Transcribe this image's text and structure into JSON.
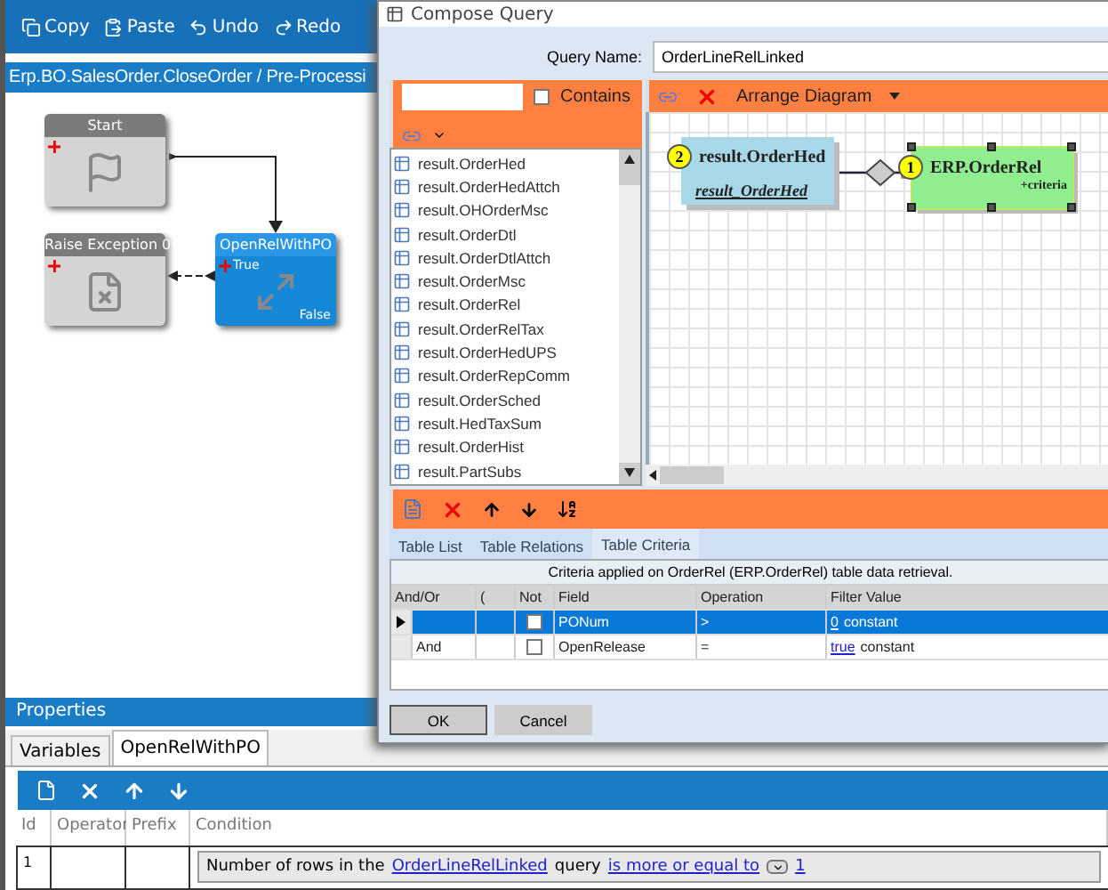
{
  "toolbar": {
    "buttons": [
      {
        "kind": "copy",
        "label": "Copy"
      },
      {
        "kind": "paste",
        "label": "Paste"
      },
      {
        "kind": "undo",
        "label": "Undo"
      },
      {
        "kind": "redo",
        "label": "Redo"
      }
    ]
  },
  "breadcrumb": "Erp.BO.SalesOrder.CloseOrder / Pre-Processi",
  "workflow": {
    "nodes": [
      {
        "kind": "start",
        "title": "Start",
        "selected": false
      },
      {
        "kind": "exception",
        "title": "Raise Exception 0",
        "selected": false
      },
      {
        "kind": "condition",
        "title": "OpenRelWithPO",
        "selected": true,
        "true_label": "True",
        "false_label": "False"
      }
    ]
  },
  "properties": {
    "title": "Properties",
    "tabs": [
      {
        "label": "Variables",
        "selected": false
      },
      {
        "label": "OpenRelWithPO",
        "selected": true
      }
    ],
    "columns": [
      "Id",
      "Operator",
      "Prefix",
      "Condition"
    ],
    "rows": [
      {
        "id": "1",
        "condition": [
          {
            "kind": "text",
            "text": "Number of rows in the"
          },
          {
            "kind": "link",
            "text": "OrderLineRelLinked"
          },
          {
            "kind": "text",
            "text": "query"
          },
          {
            "kind": "link",
            "text": "is more or equal to"
          },
          {
            "kind": "dropdown"
          },
          {
            "kind": "link",
            "text": "1"
          }
        ]
      }
    ]
  },
  "dialog": {
    "title": "Compose Query",
    "query_name": {
      "label": "Query Name:",
      "value": "OrderLineRelLinked"
    },
    "table_search": {
      "checkbox_label": "Contains",
      "checked": false
    },
    "tables": [
      "result.OrderHed",
      "result.OrderHedAttch",
      "result.OHOrderMsc",
      "result.OrderDtl",
      "result.OrderDtlAttch",
      "result.OrderMsc",
      "result.OrderRel",
      "result.OrderRelTax",
      "result.OrderHedUPS",
      "result.OrderRepComm",
      "result.OrderSched",
      "result.HedTaxSum",
      "result.OrderHist",
      "result.PartSubs"
    ],
    "diagram_toolbar": {
      "arrange_label": "Arrange Diagram"
    },
    "entities": [
      {
        "kind": "result",
        "number": "2",
        "name": "result.OrderHed",
        "alias": "result_OrderHed",
        "selected": false
      },
      {
        "kind": "table",
        "number": "1",
        "name": "ERP.OrderRel",
        "note": "+criteria",
        "selected": true
      }
    ],
    "tabs": [
      {
        "label": "Table List",
        "selected": false
      },
      {
        "label": "Table Relations",
        "selected": false
      },
      {
        "label": "Table Criteria",
        "selected": true
      }
    ],
    "criteria": {
      "caption": "Criteria applied on OrderRel (ERP.OrderRel)  table data retrieval.",
      "columns": [
        "And/Or",
        "(",
        "Not",
        "Field",
        "Operation",
        "Filter Value"
      ],
      "rows": [
        {
          "selected": true,
          "not": false,
          "field": "PONum",
          "operation": ">",
          "value": "0",
          "value_type": "constant"
        },
        {
          "selected": false,
          "and_or": "And",
          "not": false,
          "field": "OpenRelease",
          "operation": "=",
          "value": "true",
          "value_type": "constant"
        }
      ]
    },
    "buttons": [
      {
        "label": "OK",
        "selected": true
      },
      {
        "label": "Cancel",
        "selected": false
      }
    ]
  }
}
